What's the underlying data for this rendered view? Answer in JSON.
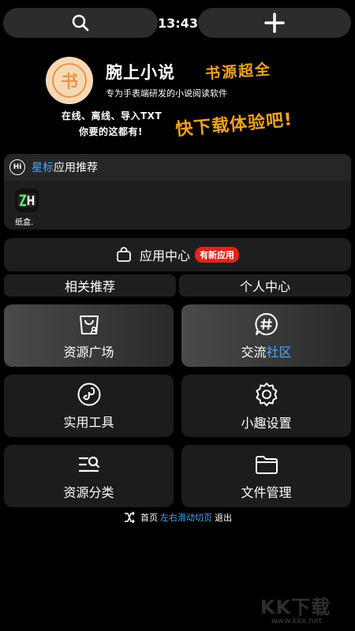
{
  "status": {
    "time": "13:43"
  },
  "banner": {
    "logo_glyph": "书",
    "app_name": "腕上小说",
    "tagline": "专为手表端研发的小说阅读软件",
    "slogan_top": "书源超全",
    "feature_line1": "在线、离线、导入TXT",
    "feature_line2": "你要的这都有!",
    "slogan_bottom": "快下载体验吧!"
  },
  "recommend": {
    "hi_label": "Hi",
    "title_accent": "星标",
    "title_rest": "应用推荐",
    "apps": [
      {
        "name": "纸盒."
      }
    ]
  },
  "app_center": {
    "label": "应用中心",
    "badge": "有新应用"
  },
  "tabs": [
    {
      "label": "相关推荐"
    },
    {
      "label": "个人中心"
    }
  ],
  "tiles": {
    "resource_square": {
      "label": "资源广场"
    },
    "community": {
      "label": "交流",
      "label_accent": "社区"
    },
    "tools": {
      "label": "实用工具"
    },
    "settings": {
      "label": "小趣设置"
    },
    "categories": {
      "label": "资源分类"
    },
    "file_manager": {
      "label": "文件管理"
    }
  },
  "footer": {
    "prefix": "首页",
    "accent": "左右滑动切页",
    "suffix": "退出"
  },
  "watermark": {
    "brand": "KK下载",
    "url": "www.kkx.net"
  },
  "colors": {
    "accent_blue": "#4aa8ff",
    "accent_orange": "#f0a21f",
    "badge_red": "#e2231a"
  },
  "icons": {
    "top_left": "search-icon",
    "top_right": "plus-icon",
    "recommend_header": "hi-chat-icon",
    "app_center": "shopping-bag-icon",
    "resource_square": "store-bag-icon",
    "community": "hashtag-chat-icon",
    "tools": "link-circle-icon",
    "settings": "gear-icon",
    "categories": "list-search-icon",
    "file_manager": "folder-icon",
    "footer": "exit-arrows-icon"
  }
}
